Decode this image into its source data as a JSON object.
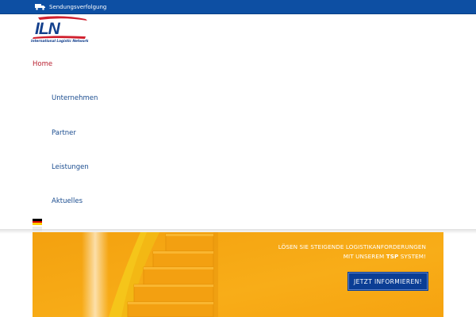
{
  "topbar": {
    "tracking_label": "Sendungsverfolgung",
    "tracking_icon": "truck-icon",
    "background": "#0d4fa3"
  },
  "logo": {
    "wordmark": "ILN",
    "caption": "International Logistic Network"
  },
  "menu": {
    "items": [
      {
        "label": "Home",
        "active": true
      },
      {
        "label": "Unternehmen",
        "active": false
      },
      {
        "label": "Partner",
        "active": false
      },
      {
        "label": "Leistungen",
        "active": false
      },
      {
        "label": "Aktuelles",
        "active": false
      }
    ],
    "language_flag": "german-flag-icon",
    "active_color": "#b81e2e",
    "item_color": "#1a4c8f"
  },
  "hero": {
    "line1": "LÖSEN SIE STEIGENDE LOGISTIKANFORDERUNGEN",
    "line2_prefix": "MIT UNSEREM",
    "line2_bold": "TSP",
    "line2_suffix": "SYSTEM!",
    "button_label": "JETZT INFORMIEREN!",
    "background": "#f7a812",
    "button_color": "#0b3e95"
  }
}
